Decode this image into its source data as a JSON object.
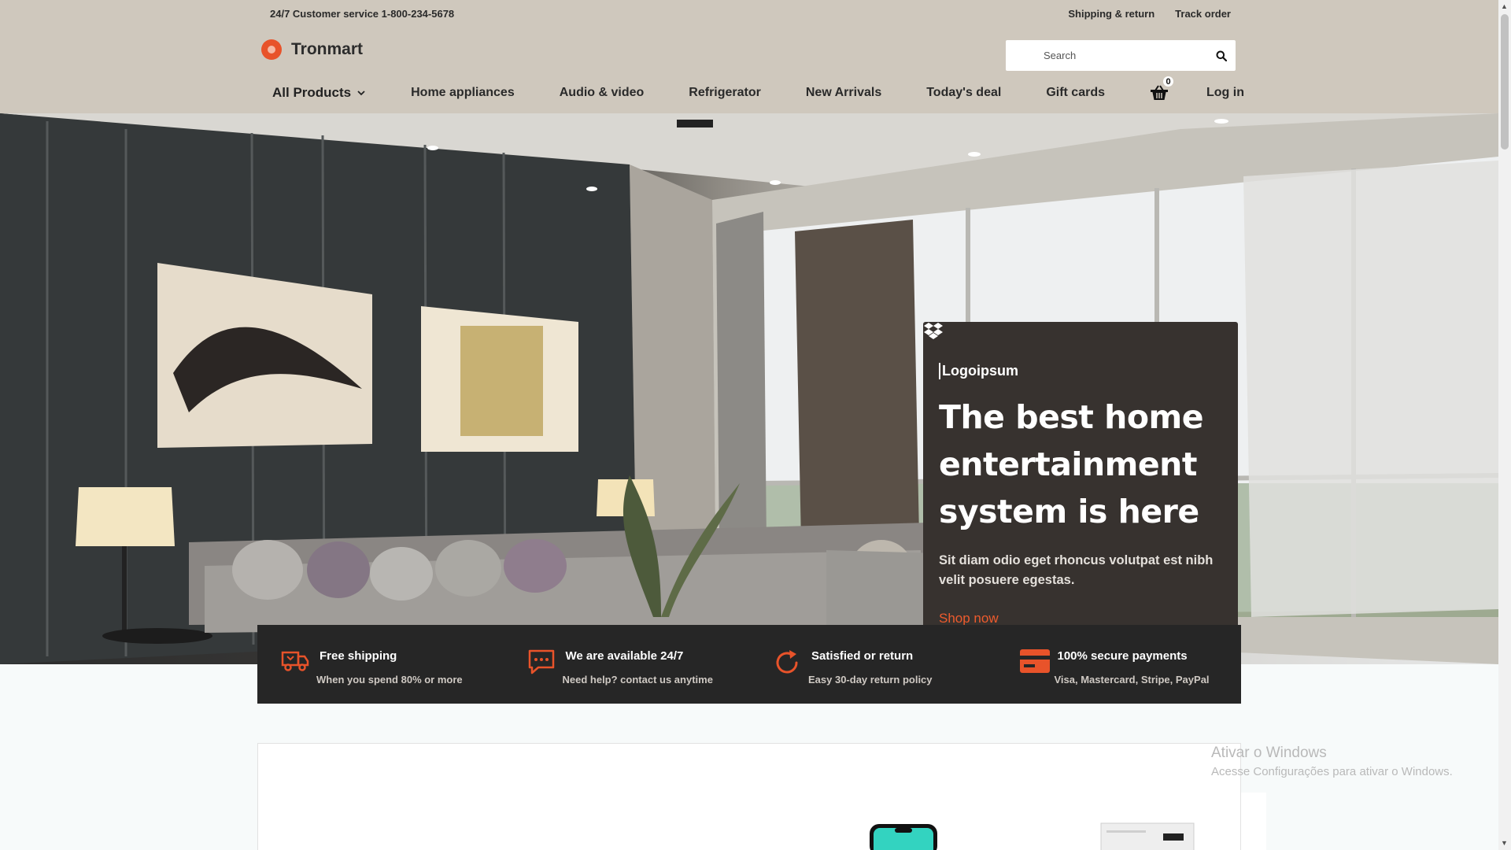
{
  "topbar": {
    "customer_service": "24/7 Customer service 1-800-234-5678",
    "links": [
      "Shipping & return",
      "Track order"
    ]
  },
  "brand": {
    "name": "Tronmart",
    "accent": "#e8532a"
  },
  "search": {
    "placeholder": "Search",
    "icon": "search-icon"
  },
  "nav": {
    "all_products": "All Products",
    "items": [
      "Home appliances",
      "Audio & video",
      "Refrigerator",
      "New Arrivals",
      "Today's deal",
      "Gift cards"
    ],
    "cart_count": "0",
    "login": "Log in"
  },
  "promo": {
    "brand": "Logoipsum",
    "title": "The best home entertainment system is here",
    "text": "Sit diam odio eget rhoncus volutpat est nibh velit posuere egestas.",
    "cta": "Shop now",
    "cta_color": "#ee5b2d"
  },
  "features": [
    {
      "icon": "truck-icon",
      "title": "Free shipping",
      "subtitle": "When you spend 80% or more"
    },
    {
      "icon": "chat-icon",
      "title": "We are available 24/7",
      "subtitle": "Need help? contact us anytime"
    },
    {
      "icon": "refresh-icon",
      "title": "Satisfied or return",
      "subtitle": "Easy 30-day return policy"
    },
    {
      "icon": "credit-card-icon",
      "title": "100% secure payments",
      "subtitle": "Visa, Mastercard, Stripe, PayPal"
    }
  ],
  "watermark": {
    "title": "Ativar o Windows",
    "subtitle": "Acesse Configurações para ativar o Windows."
  }
}
